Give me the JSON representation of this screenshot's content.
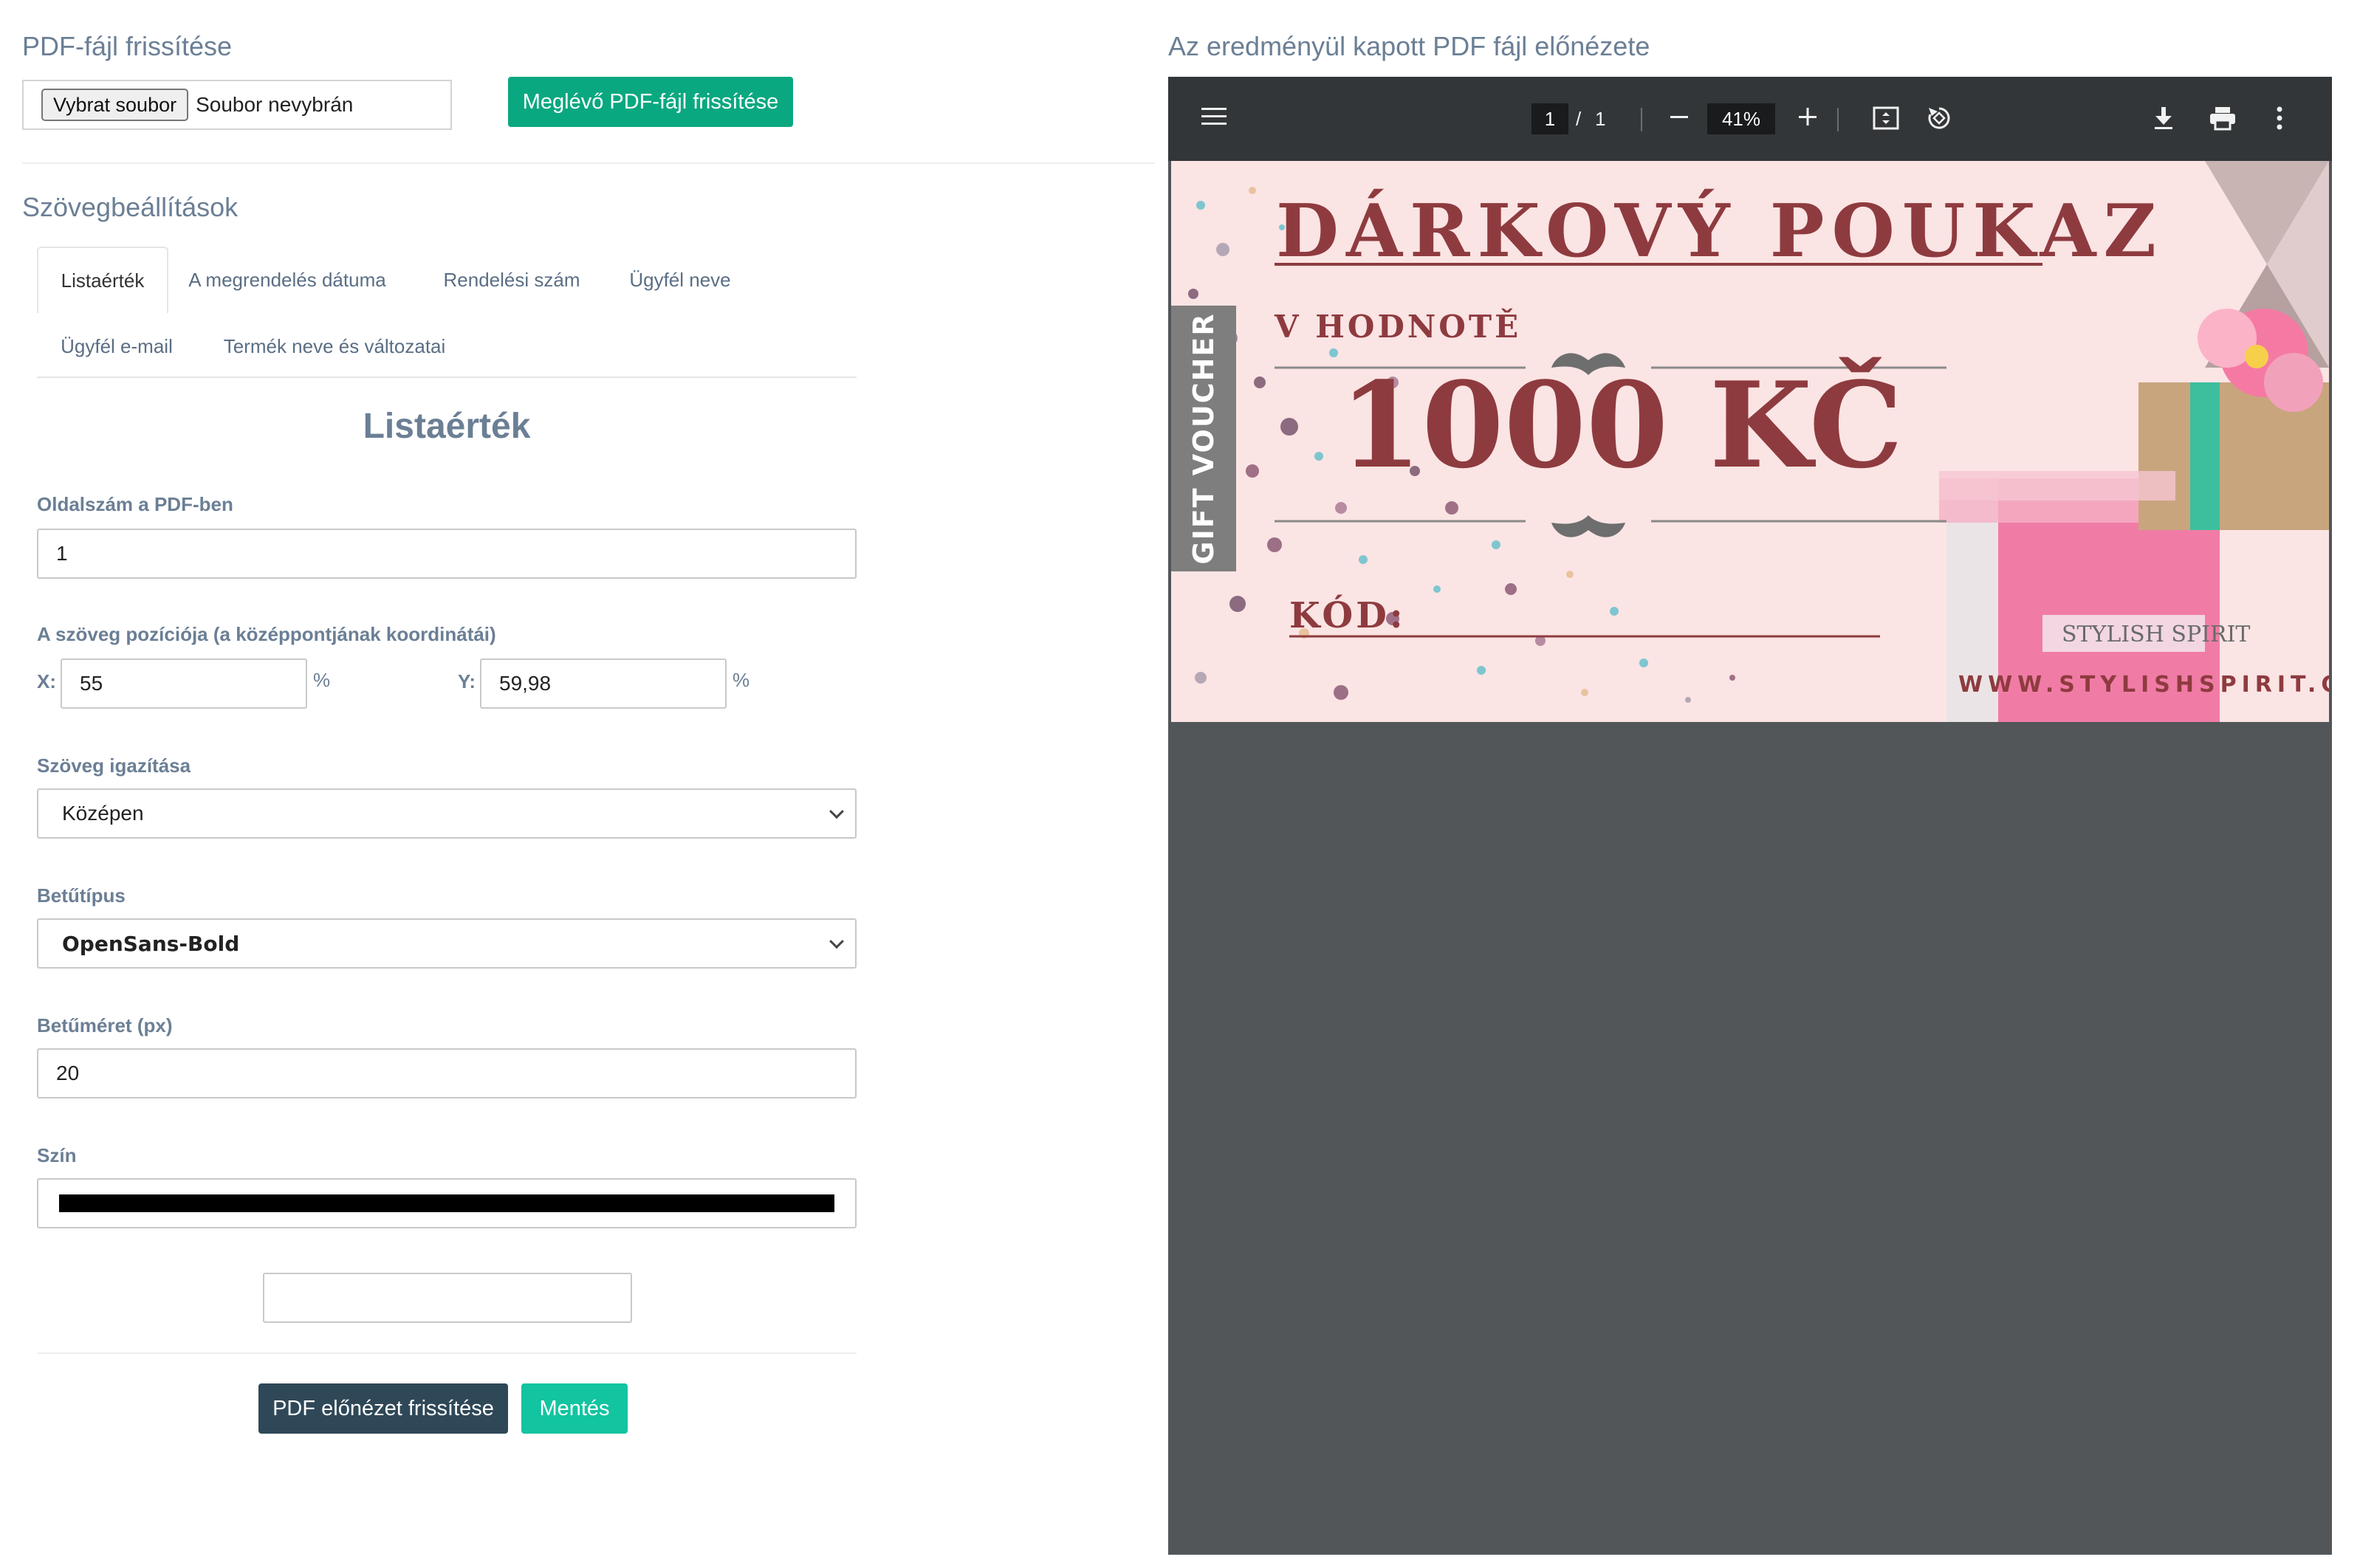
{
  "left": {
    "section_pdf_update": "PDF-fájl frissítése",
    "file_button": "Vybrat soubor",
    "file_name": "Soubor nevybrán",
    "update_existing_button": "Meglévő PDF-fájl frissítése",
    "section_text_settings": "Szövegbeállítások",
    "tabs": [
      {
        "label": "Listaérték",
        "active": true
      },
      {
        "label": "A megrendelés dátuma"
      },
      {
        "label": "Rendelési szám"
      },
      {
        "label": "Ügyfél neve"
      },
      {
        "label": "Ügyfél e-mail"
      },
      {
        "label": "Termék neve és változatai"
      }
    ],
    "panel_title": "Listaérték",
    "page_number_label": "Oldalszám a PDF-ben",
    "page_number_value": "1",
    "position_label": "A szöveg pozíciója (a középpontjának koordinátái)",
    "x_label": "X:",
    "x_value": "55",
    "y_label": "Y:",
    "y_value": "59,98",
    "percent": "%",
    "alignment_label": "Szöveg igazítása",
    "alignment_value": "Középen",
    "font_label": "Betűtípus",
    "font_value": "OpenSans-Bold",
    "font_size_label": "Betűméret (px)",
    "font_size_value": "20",
    "color_label": "Szín",
    "color_value": "#000000",
    "extra_input_value": "",
    "preview_button": "PDF előnézet frissítése",
    "save_button": "Mentés"
  },
  "right": {
    "section_preview": "Az eredményül kapott PDF fájl előnézete",
    "viewer": {
      "page_current": "1",
      "page_separator": "/",
      "page_total": "1",
      "zoom": "41%"
    },
    "voucher": {
      "title": "DÁRKOVÝ POUKAZ",
      "subtitle": "V HODNOTĚ",
      "amount": "1000 KČ",
      "side_label": "GIFT VOUCHER",
      "code_label": "KÓD:",
      "brand": "STYLISH SPIRIT",
      "website": "WWW.STYLISHSPIRIT.CZ"
    }
  },
  "colors": {
    "accent_green": "#0aa880",
    "accent_teal": "#12c4a0",
    "dark_button": "#2f4858",
    "label_text": "#6b7f95",
    "voucher_red": "#8e3b3f",
    "voucher_bg": "#fbe4e4"
  }
}
